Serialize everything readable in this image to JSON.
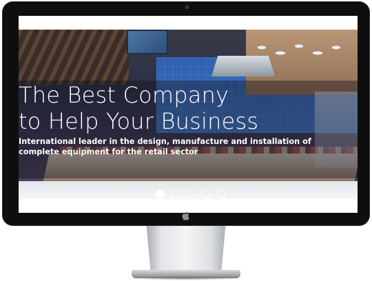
{
  "hero": {
    "headline_line1": "The Best Company",
    "headline_line2": "to Help Your Business",
    "subline": "International leader in the design, manufacture and installation of complete equipment for the retail sector"
  },
  "slider": {
    "slide_count": 5,
    "active_index": 0
  },
  "colors": {
    "bezel": "#0e0e0f",
    "text": "#ffffff",
    "overlay": "rgba(22,20,30,0.42)"
  },
  "icons": {
    "camera": "camera-dot",
    "logo": "apple-logo-icon"
  }
}
